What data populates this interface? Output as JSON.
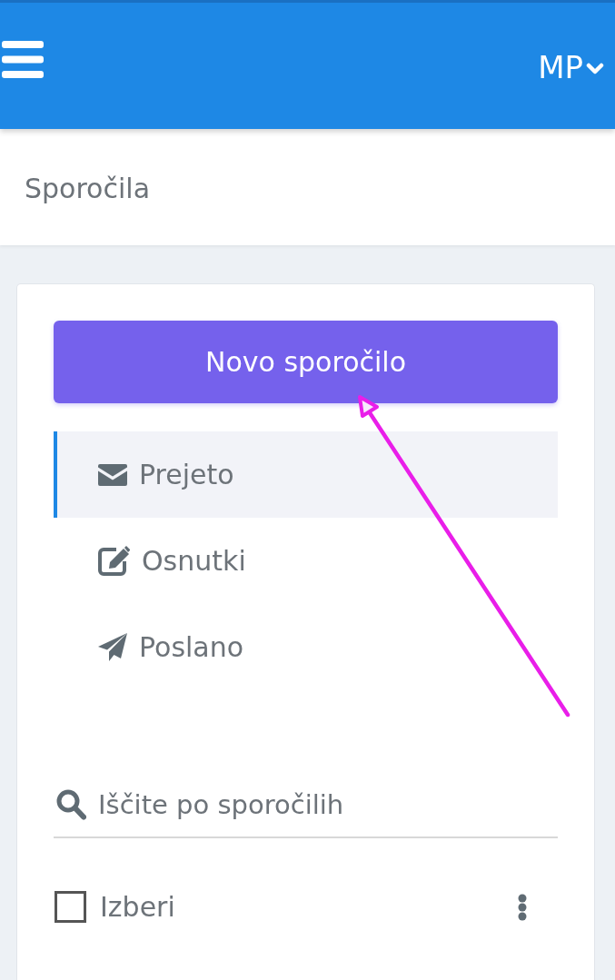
{
  "top_bar": {
    "user_initials": "MP"
  },
  "page_title": "Sporočila",
  "new_message_button": {
    "label": "Novo sporočilo"
  },
  "folders": [
    {
      "kind": "inbox",
      "label": "Prejeto",
      "selected": true
    },
    {
      "kind": "drafts",
      "label": "Osnutki",
      "selected": false
    },
    {
      "kind": "sent",
      "label": "Poslano",
      "selected": false
    }
  ],
  "search": {
    "placeholder": "Iščite po sporočilih"
  },
  "select_all": {
    "label": "Izberi",
    "checked": false
  }
}
